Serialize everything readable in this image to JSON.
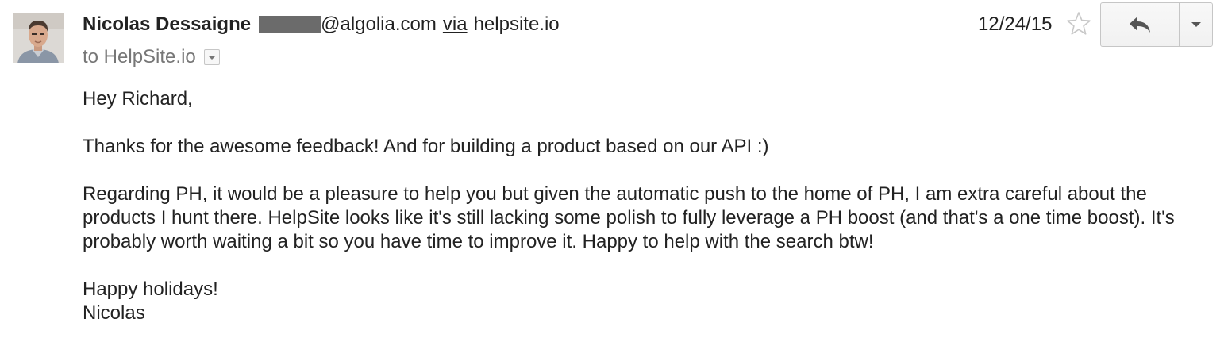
{
  "sender": {
    "name": "Nicolas Dessaigne",
    "email_domain": "@algolia.com",
    "via_label": "via",
    "via_site": "helpsite.io"
  },
  "recipient": {
    "to_text": "to HelpSite.io"
  },
  "date": "12/24/15",
  "icons": {
    "avatar": "avatar-photo",
    "star": "star-outline-icon",
    "reply": "reply-arrow-icon",
    "more": "chevron-down-icon",
    "recipient_details": "caret-down-icon"
  },
  "colors": {
    "text": "#222222",
    "secondary_text": "#777777",
    "redaction": "#6b6b6b",
    "button_border": "#c6c6c6"
  },
  "message": {
    "greeting": "Hey Richard,",
    "paragraph_1": "Thanks for the awesome feedback! And for building a product based on our API :)",
    "paragraph_2": "Regarding PH, it would be a pleasure to help you but given the automatic push to the home of PH, I am extra careful about the products I hunt there. HelpSite looks like it's still lacking some polish to fully leverage a PH boost (and that's a one time boost). It's probably worth waiting a bit so you have time to improve it. Happy to help with the search btw!",
    "closing": "Happy holidays!",
    "signature": "Nicolas"
  }
}
